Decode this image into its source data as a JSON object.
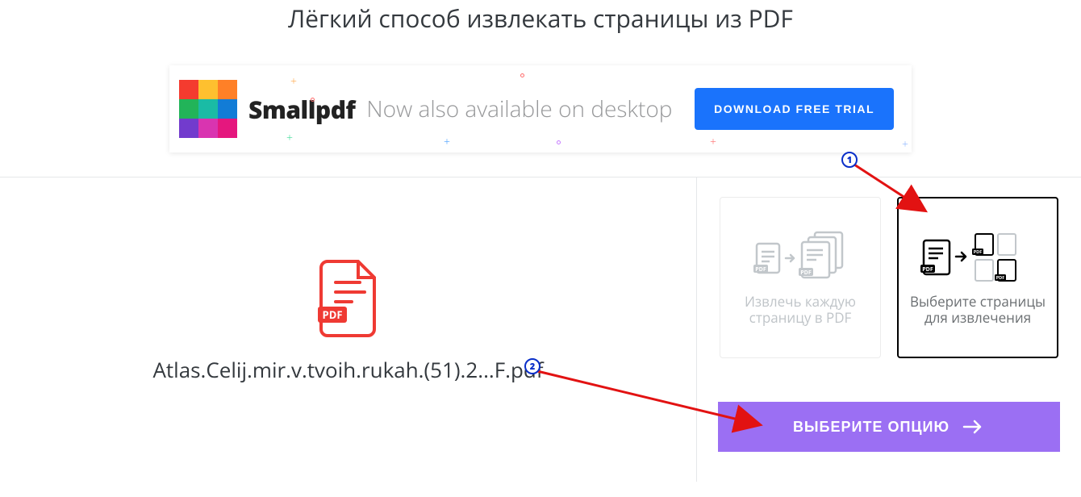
{
  "headline": "Лёгкий способ извлекать страницы из PDF",
  "banner": {
    "title": "Smallpdf",
    "subtitle": "Now also available on desktop",
    "download_label": "DOWNLOAD FREE TRIAL",
    "logo_colors": [
      "#f43b2f",
      "#fec02f",
      "#ff8027",
      "#22b459",
      "#1abba5",
      "#127cd6",
      "#723bcd",
      "#d934b0",
      "#e5177e"
    ]
  },
  "file": {
    "name": "Atlas.Celij.mir.v.tvoih.rukah.(51).2...F.pdf",
    "badge": "PDF"
  },
  "options": {
    "extract_all": "Извлечь каждую страницу в PDF",
    "select_pages": "Выберите страницы для извлечения"
  },
  "select_button": "ВЫБЕРИТЕ ОПЦИЮ",
  "annotations": {
    "one": "1",
    "two": "2"
  }
}
